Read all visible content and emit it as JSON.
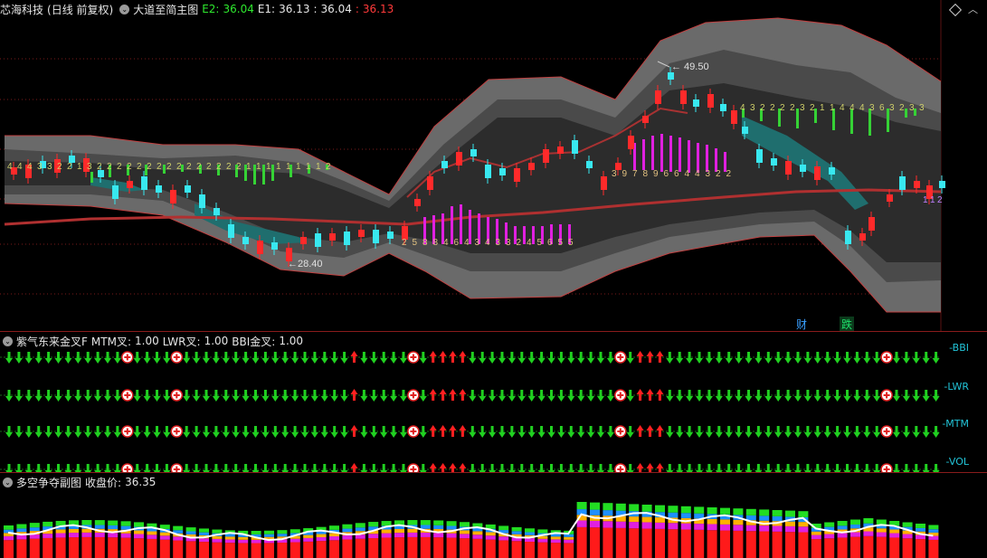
{
  "main": {
    "stock_name": "芯海科技",
    "period": "(日线 前复权)",
    "indicator": "大道至简主图",
    "e2_label": "E2:",
    "e2_value": "36.04",
    "e1_label": "E1:",
    "e1_value": "36.13",
    "value3": "36.04",
    "value4": "36.13",
    "high_annotation": "49.50",
    "low_annotation": "28.40",
    "badge_cai": "财",
    "badge_die": "跌",
    "count_labels_top": [
      "4",
      "4",
      "4",
      "3",
      "3",
      "2",
      "2",
      "1",
      "3",
      "2",
      "2",
      "2",
      "2",
      "2",
      "2",
      "2",
      "2",
      "2",
      "2",
      "2",
      "2",
      "2",
      "2",
      "2",
      "1",
      "1",
      "1",
      "1",
      "1",
      "1",
      "1",
      "1",
      "2"
    ],
    "count_labels_mid": [
      "3",
      "9",
      "7",
      "8",
      "9",
      "6",
      "6",
      "4",
      "4",
      "3",
      "2",
      "2"
    ],
    "count_labels_bottom": [
      "2",
      "5",
      "8",
      "8",
      "4",
      "6",
      "4",
      "3",
      "4",
      "3",
      "3",
      "2",
      "4",
      "5",
      "6",
      "5",
      "5"
    ],
    "count_labels_right": [
      "4",
      "3",
      "2",
      "2",
      "2",
      "2",
      "3",
      "2",
      "1",
      "1",
      "4",
      "4",
      "4",
      "3",
      "6",
      "3",
      "2",
      "3",
      "3"
    ],
    "count_labels_small": [
      "1",
      "1",
      "2"
    ],
    "colors": {
      "up": "#ff2a2a",
      "down": "#38e8f0",
      "band_outer": "#6a6a6a",
      "band_mid": "#4a4a4a",
      "band_inner": "#2c2c2c",
      "ma_long": "#b03030",
      "teal": "#1f6e6e",
      "green_bar": "#35d235",
      "magenta_bar": "#e020e0"
    }
  },
  "signal": {
    "title": "紫气东来金叉F",
    "mtm_label": "MTM叉:",
    "mtm_value": "1.00",
    "lwr_label": "LWR叉:",
    "lwr_value": "1.00",
    "bbi_label": "BBI金叉:",
    "bbi_value": "1.00",
    "rows": [
      "-BBI",
      "-LWR",
      "-MTM",
      "-VOL"
    ]
  },
  "sub": {
    "title": "多空争夺副图",
    "close_label": "收盘价:",
    "close_value": "36.35"
  }
}
